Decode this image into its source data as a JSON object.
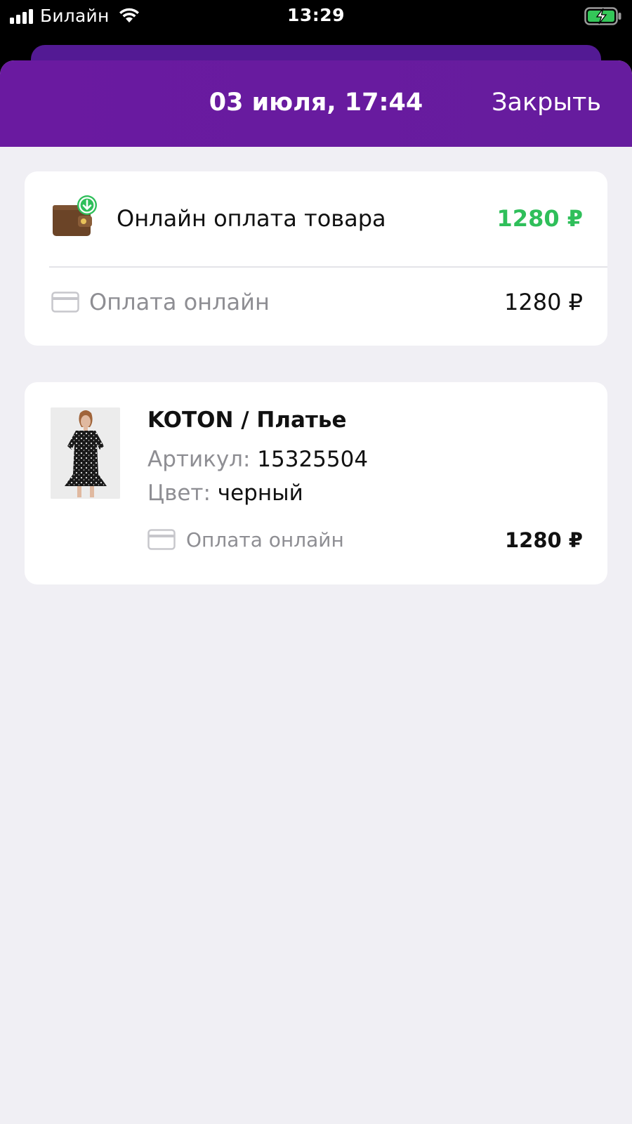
{
  "status_bar": {
    "carrier": "Билайн",
    "time": "13:29"
  },
  "header": {
    "title": "03 июля, 17:44",
    "close_label": "Закрыть"
  },
  "payment": {
    "title": "Онлайн оплата товара",
    "amount": "1280 ₽",
    "method_label": "Оплата онлайн",
    "method_amount": "1280 ₽"
  },
  "item": {
    "title": "KOTON / Платье",
    "sku_label": "Артикул:",
    "sku_value": "15325504",
    "color_label": "Цвет:",
    "color_value": "черный",
    "method_label": "Оплата онлайн",
    "amount": "1280 ₽"
  },
  "colors": {
    "header": "#6a1aa0",
    "amount_green": "#2fbf5a",
    "background": "#f0eff4"
  }
}
